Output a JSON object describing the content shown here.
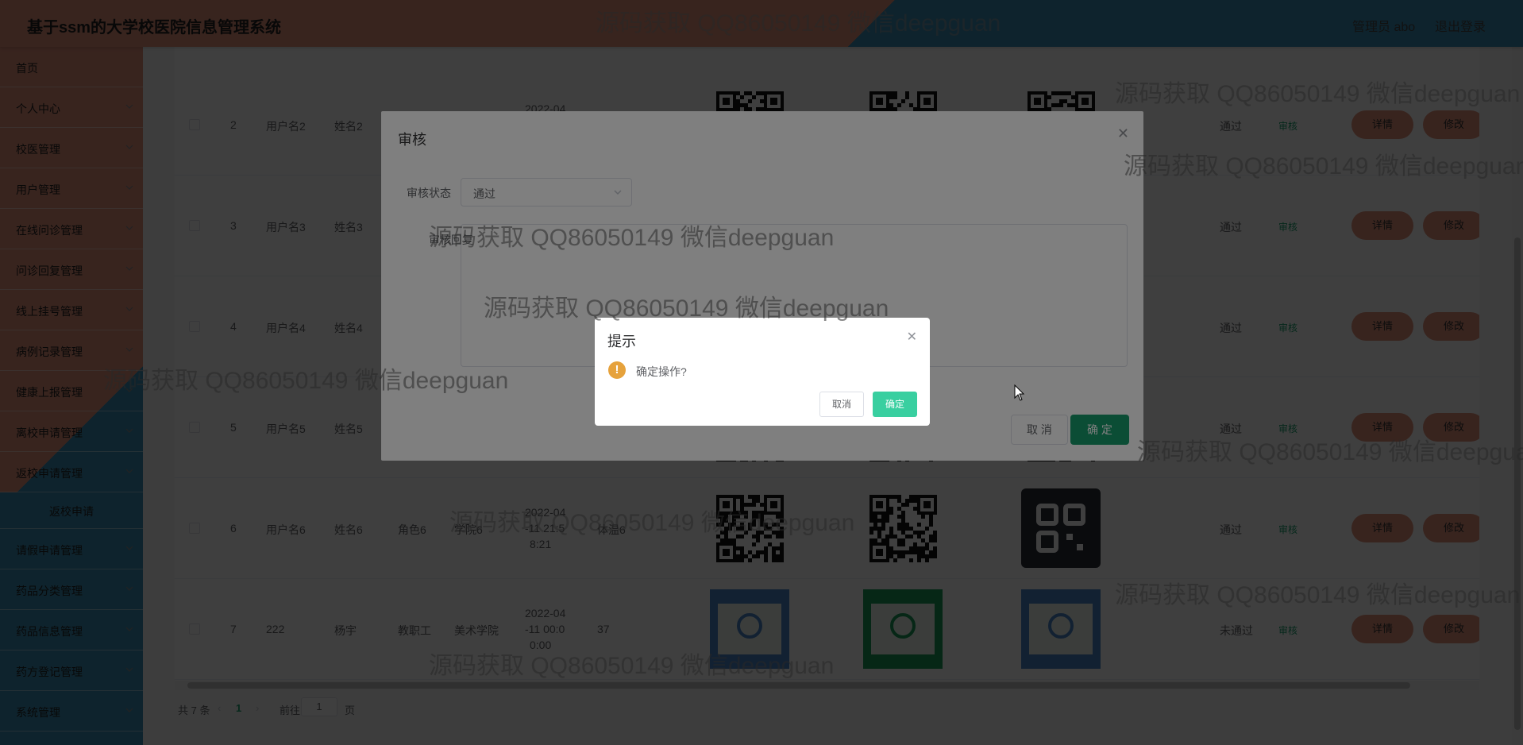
{
  "header": {
    "title": "基于ssm的大学校医院信息管理系统",
    "user": "管理员 abo",
    "logout": "退出登录"
  },
  "sidebar": {
    "items": [
      {
        "label": "首页",
        "chevron": false
      },
      {
        "label": "个人中心",
        "chevron": true
      },
      {
        "label": "校医管理",
        "chevron": true
      },
      {
        "label": "用户管理",
        "chevron": true
      },
      {
        "label": "在线问诊管理",
        "chevron": true
      },
      {
        "label": "问诊回复管理",
        "chevron": true
      },
      {
        "label": "线上挂号管理",
        "chevron": true
      },
      {
        "label": "病例记录管理",
        "chevron": true
      },
      {
        "label": "健康上报管理",
        "chevron": true
      },
      {
        "label": "离校申请管理",
        "chevron": true
      },
      {
        "label": "返校申请管理",
        "chevron": true
      }
    ],
    "active_submenu": "返校申请",
    "items_after": [
      {
        "label": "请假申请管理"
      },
      {
        "label": "药品分类管理"
      },
      {
        "label": "药品信息管理"
      },
      {
        "label": "药方登记管理"
      },
      {
        "label": "系统管理"
      }
    ]
  },
  "table": {
    "rows": [
      {
        "index": "2",
        "username": "用户名2",
        "name": "姓名2",
        "role": "",
        "college": "",
        "date": "2022-04",
        "temp": "",
        "status": "通过"
      },
      {
        "index": "3",
        "username": "用户名3",
        "name": "姓名3",
        "role": "",
        "college": "",
        "date": "",
        "temp": "",
        "status": "通过"
      },
      {
        "index": "4",
        "username": "用户名4",
        "name": "姓名4",
        "role": "",
        "college": "",
        "date": "",
        "temp": "",
        "status": "通过"
      },
      {
        "index": "5",
        "username": "用户名5",
        "name": "姓名5",
        "role": "",
        "college": "",
        "date": "",
        "temp": "",
        "status": "通过"
      },
      {
        "index": "6",
        "username": "用户名6",
        "name": "姓名6",
        "role": "角色6",
        "college": "学院6",
        "date": "2022-04",
        "date2": "-11 21:5",
        "date3": "8:21",
        "temp": "体温6",
        "status": "通过"
      },
      {
        "index": "7",
        "username": "222",
        "name": "杨宇",
        "role": "教职工",
        "college": "美术学院",
        "date": "2022-04",
        "date2": "-11 00:0",
        "date3": "0:00",
        "temp": "37",
        "status": "未通过"
      }
    ],
    "audit_label": "审核",
    "detail_label": "详情",
    "edit_label": "修改"
  },
  "pager": {
    "total": "共 7 条",
    "current": "1",
    "goto": "前往",
    "page_value": "1",
    "page_unit": "页"
  },
  "audit_dialog": {
    "title": "审核",
    "status_label": "审核状态",
    "status_value": "通过",
    "reply_label": "审核回复",
    "cancel": "取 消",
    "ok": "确 定"
  },
  "confirm_dialog": {
    "title": "提示",
    "message": "确定操作?",
    "cancel": "取消",
    "ok": "确定"
  },
  "watermark": "源码获取 QQ86050149 微信deepguan",
  "colors": {
    "salmon": "#e2907a",
    "blue": "#3a8fb7",
    "green": "#179b6b",
    "confirm_green": "#39cfa0",
    "warning": "#e6a23c"
  }
}
